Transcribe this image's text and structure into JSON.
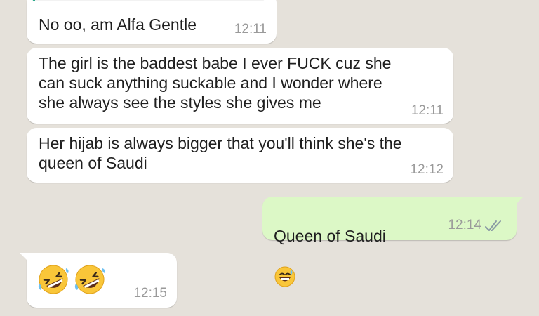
{
  "colors": {
    "background": "#e5e1da",
    "incoming_bubble": "#ffffff",
    "outgoing_bubble": "#dcf8c6",
    "quote_bar": "#2aa88a",
    "timestamp": "#9a9a9a",
    "read_ticks": "#8a9aa4"
  },
  "messages": [
    {
      "direction": "in",
      "text": "No oo, am Alfa Gentle",
      "time": "12:11"
    },
    {
      "direction": "in",
      "text": "The girl is the baddest babe I ever FUCK cuz she\ncan suck anything suckable and I wonder where\nshe always see the styles she gives me",
      "time": "12:11"
    },
    {
      "direction": "in",
      "text": "Her hijab is always bigger that you'll think she's the\nqueen of Saudi",
      "time": "12:12"
    },
    {
      "direction": "out",
      "text": "Queen of Saudi",
      "emoji": "grinning-sweat-emoji",
      "time": "12:14",
      "status_icon": "double-check-icon"
    },
    {
      "direction": "in",
      "emoji": [
        "rolling-on-floor-laughing-emoji",
        "rolling-on-floor-laughing-emoji"
      ],
      "time": "12:15"
    }
  ]
}
